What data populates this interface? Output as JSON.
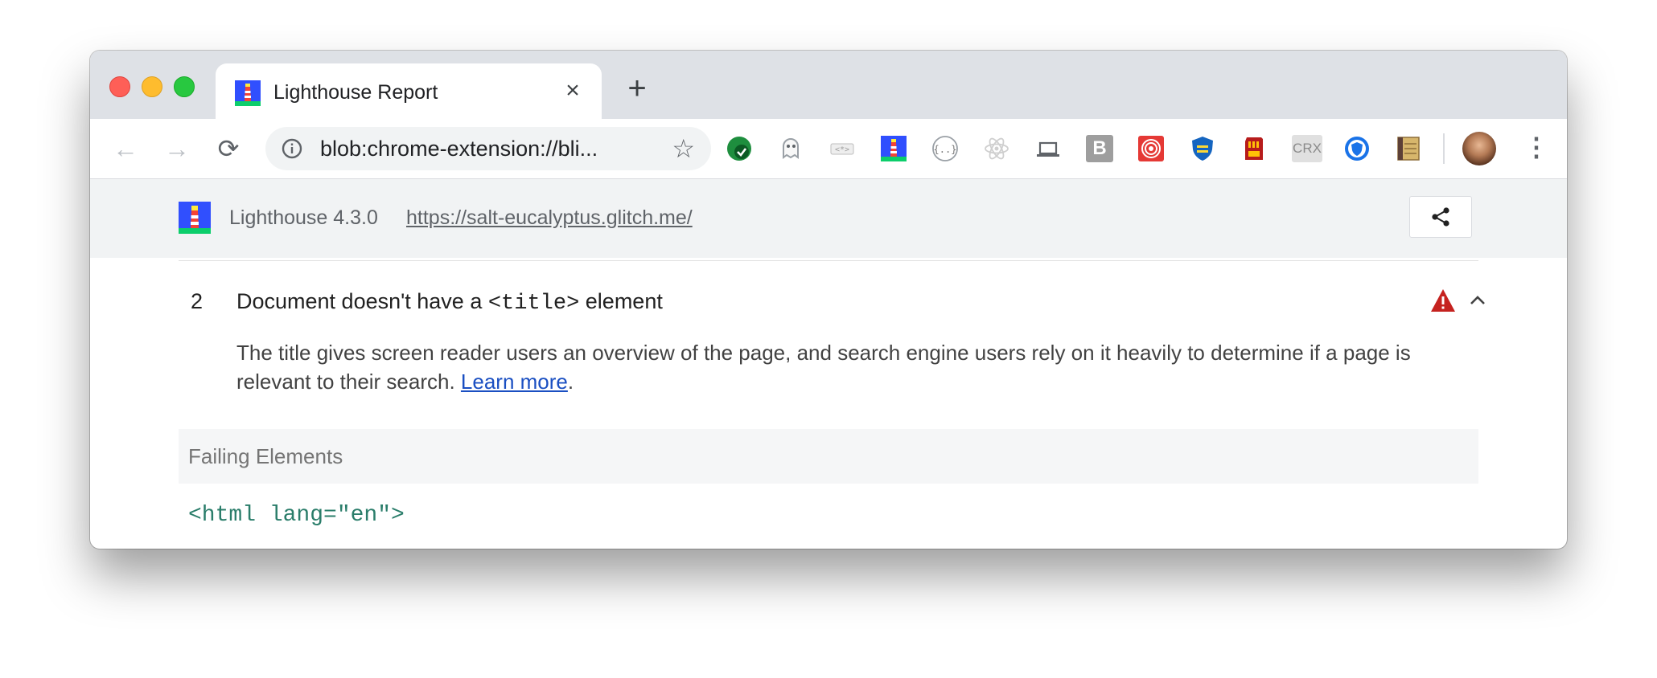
{
  "browser": {
    "tab": {
      "title": "Lighthouse Report",
      "close_glyph": "×"
    },
    "new_tab_glyph": "+",
    "nav": {
      "back_glyph": "←",
      "forward_glyph": "→",
      "reload_glyph": "⟳"
    },
    "omnibox": {
      "url": "blob:chrome-extension://bli...",
      "star_glyph": "☆"
    },
    "extensions": [
      "check-extension-icon",
      "ghost-extension-icon",
      "code-extension-icon",
      "lighthouse-extension-icon",
      "json-extension-icon",
      "react-extension-icon",
      "laptop-extension-icon",
      "b-extension-icon",
      "target-extension-icon",
      "shield-extension-icon",
      "sd-card-extension-icon",
      "crx-extension-icon",
      "privacy-extension-icon",
      "notes-extension-icon"
    ],
    "crx_label": "CRX",
    "b_label": "B",
    "menu_glyph": "⋮"
  },
  "lighthouse": {
    "version": "Lighthouse 4.3.0",
    "url": "https://salt-eucalyptus.glitch.me/"
  },
  "audit": {
    "index": "2",
    "title_before": "Document doesn't have a ",
    "title_code": "<title>",
    "title_after": " element",
    "description": "The title gives screen reader users an overview of the page, and search engine users rely on it heavily to determine if a page is relevant to their search. ",
    "learn_more": "Learn more",
    "period": ".",
    "failing_elements_label": "Failing Elements",
    "failing_element_code": "<html lang=\"en\">"
  },
  "colors": {
    "warning": "#c5221f",
    "link": "#1a4fc2",
    "code": "#2a7d6a"
  }
}
